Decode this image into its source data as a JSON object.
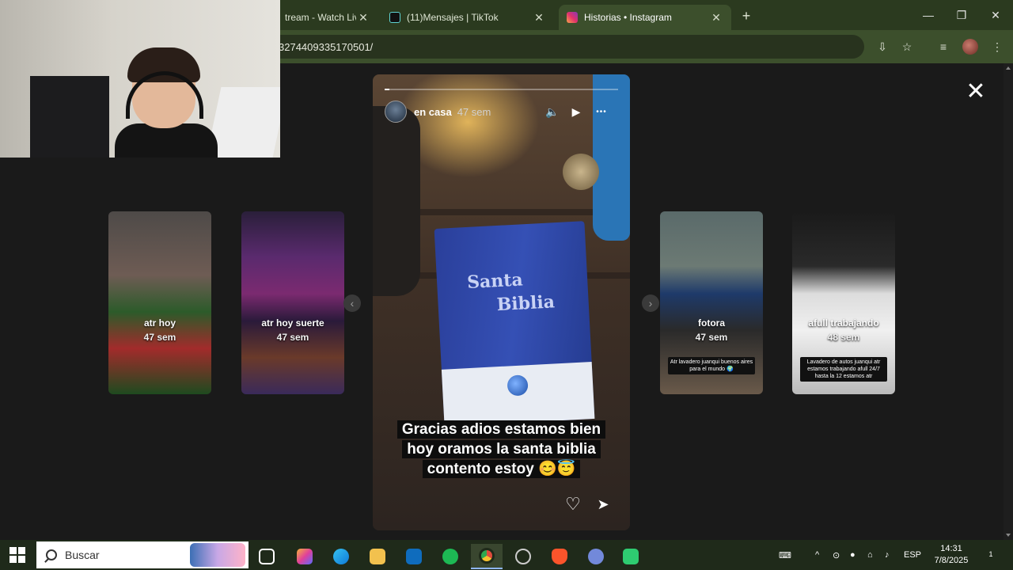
{
  "browser": {
    "tabs": [
      {
        "title": "tream - Watch Live",
        "close": "✕"
      },
      {
        "title": "(11)Mensajes | TikTok",
        "close": "✕"
      },
      {
        "title": "Historias • Instagram",
        "close": "✕"
      }
    ],
    "new_tab": "+",
    "window_controls": {
      "minimize": "—",
      "restore": "❐",
      "close": "✕"
    },
    "address": "3274409335170501/",
    "toolbar_icons": [
      "install-icon",
      "star-icon",
      "reading-list-icon",
      "profile-avatar",
      "menu-icon"
    ]
  },
  "stories": {
    "close_label": "✕",
    "thumbnails_left": [
      {
        "user": "atr hoy",
        "time": "47 sem"
      },
      {
        "user": "atr hoy suerte",
        "time": "47 sem"
      }
    ],
    "thumbnails_right": [
      {
        "user": "fotora",
        "time": "47 sem",
        "caption": "Atr lavadero juanqui buenos aires para el mundo 🌍"
      },
      {
        "user": "afull trabajando",
        "time": "48 sem",
        "caption": "Lavadero de autos juanqui atr estamos trabajando afull 24/7 hasta la 12 estamos atr"
      }
    ],
    "prev_arrow": "‹",
    "next_arrow": "›",
    "active": {
      "user": "en casa",
      "time": "47 sem",
      "progress": 0.02,
      "book_title_line1": "Santa",
      "book_title_line2": "Biblia",
      "caption_lines": [
        "Gracias adios estamos bien",
        "hoy oramos la santa biblia",
        "contento estoy 😊😇"
      ],
      "controls": {
        "mute": "🔈",
        "play": "▶",
        "more": "•••"
      },
      "actions": {
        "like": "♡",
        "share": "➤"
      }
    }
  },
  "taskbar": {
    "search_placeholder": "Buscar",
    "apps": [
      {
        "name": "task-view",
        "color": "#ffffff"
      },
      {
        "name": "copilot",
        "color": "#7a5cff"
      },
      {
        "name": "edge",
        "color": "#1e9ede"
      },
      {
        "name": "file-explorer",
        "color": "#f2c14e"
      },
      {
        "name": "outlook",
        "color": "#0f6cbd"
      },
      {
        "name": "spotify",
        "color": "#1db954"
      },
      {
        "name": "chrome",
        "color": "#e04b3c"
      },
      {
        "name": "clock-app",
        "color": "#bbbbbb"
      },
      {
        "name": "brave",
        "color": "#fb542b"
      },
      {
        "name": "discord",
        "color": "#7289da"
      },
      {
        "name": "stream-app",
        "color": "#2ecc71"
      }
    ],
    "tray": {
      "language": "ESP",
      "up_arrow": "^"
    },
    "time": "14:31",
    "date": "7/8/2025",
    "notification_count": "1"
  }
}
